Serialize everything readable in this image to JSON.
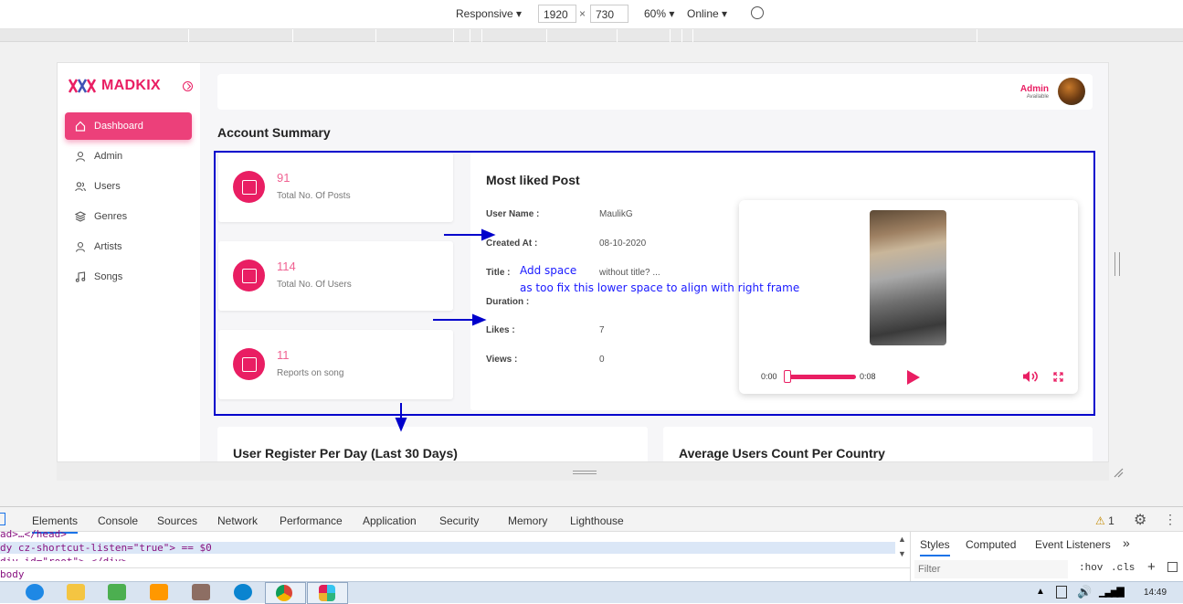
{
  "device_toolbar": {
    "mode": "Responsive",
    "width": "1920",
    "height": "730",
    "zoom": "60%",
    "network": "Online"
  },
  "brand": {
    "name": "MADKIX"
  },
  "sidebar": {
    "items": [
      {
        "label": "Dashboard",
        "icon": "home-icon"
      },
      {
        "label": "Admin",
        "icon": "user-icon"
      },
      {
        "label": "Users",
        "icon": "users-icon"
      },
      {
        "label": "Genres",
        "icon": "layers-icon"
      },
      {
        "label": "Artists",
        "icon": "user-icon"
      },
      {
        "label": "Songs",
        "icon": "music-icon"
      }
    ]
  },
  "header": {
    "user_name": "Admin",
    "user_status": "Available"
  },
  "main": {
    "section_title": "Account Summary",
    "stats": [
      {
        "value": "91",
        "label": "Total No. Of Posts"
      },
      {
        "value": "114",
        "label": "Total No. Of Users"
      },
      {
        "value": "11",
        "label": "Reports on song"
      }
    ],
    "most_liked": {
      "title": "Most liked Post",
      "fields": [
        {
          "label": "User Name :",
          "value": "MaulikG"
        },
        {
          "label": "Created At :",
          "value": "08-10-2020"
        },
        {
          "label": "Title :",
          "value": "without title? ..."
        },
        {
          "label": "Duration :",
          "value": ""
        },
        {
          "label": "Likes :",
          "value": "7"
        },
        {
          "label": "Views :",
          "value": "0"
        }
      ],
      "player": {
        "current_time": "0:00",
        "total_time": "0:08"
      }
    },
    "charts": [
      {
        "title": "User Register Per Day (Last 30 Days)"
      },
      {
        "title": "Average Users Count Per Country"
      }
    ]
  },
  "annotations": {
    "line1": "Add space",
    "line2": "as too fix this lower space to align with right frame"
  },
  "devtools": {
    "tabs": [
      "Elements",
      "Console",
      "Sources",
      "Network",
      "Performance",
      "Application",
      "Security",
      "Memory",
      "Lighthouse"
    ],
    "warning_count": "1",
    "code_line1": "ad>…</head>",
    "code_line2": "dy cz-shortcut-listen=\"true\"> == $0",
    "code_line3": "div id=\"root\">…</div>",
    "breadcrumb": "body",
    "styles_tabs": [
      "Styles",
      "Computed",
      "Event Listeners"
    ],
    "filter_placeholder": "Filter",
    "hov": ":hov",
    "cls": ".cls"
  },
  "taskbar": {
    "time": "14:49"
  }
}
